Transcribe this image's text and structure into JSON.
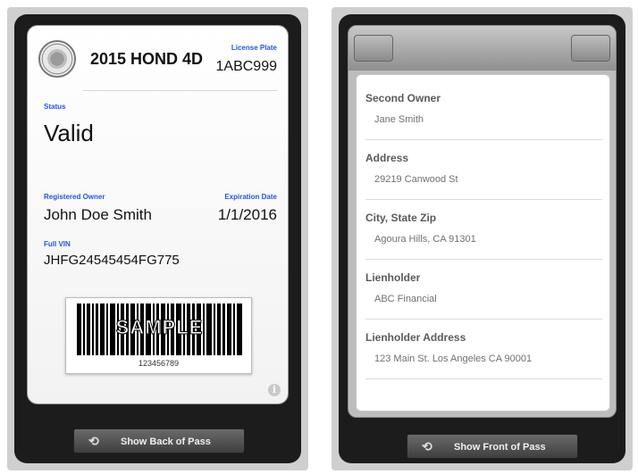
{
  "front": {
    "vehicle_title": "2015 HOND 4D",
    "license_plate_label": "License Plate",
    "license_plate_value": "1ABC999",
    "status_label": "Status",
    "status_value": "Valid",
    "owner_label": "Registered Owner",
    "owner_value": "John Doe Smith",
    "expiration_label": "Expiration Date",
    "expiration_value": "1/1/2016",
    "vin_label": "Full VIN",
    "vin_value": "JHFG24545454FG775",
    "barcode_overlay": "SAMPLE",
    "barcode_number": "123456789",
    "info_icon": "info-icon",
    "flip_button_label": "Show Back of Pass",
    "flip_icon": "flip-arrows-icon"
  },
  "back": {
    "rows": [
      {
        "label": "Second Owner",
        "value": "Jane Smith"
      },
      {
        "label": "Address",
        "value": "29219 Canwood St"
      },
      {
        "label": "City, State Zip",
        "value": "Agoura Hills, CA 91301"
      },
      {
        "label": "Lienholder",
        "value": "ABC Financial"
      },
      {
        "label": "Lienholder Address",
        "value": "123 Main St. Los Angeles CA 90001"
      }
    ],
    "flip_button_label": "Show Front of Pass",
    "flip_icon": "flip-arrows-icon"
  },
  "colors": {
    "field_label_blue": "#2a54d8",
    "screen_dark": "#1c1c1c"
  }
}
